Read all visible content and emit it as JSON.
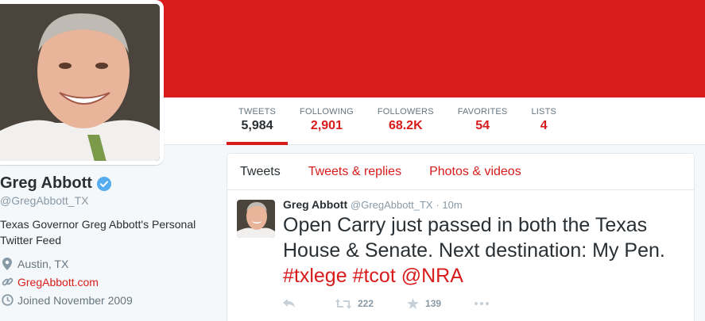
{
  "theme": {
    "accent": "#d81b1b",
    "text": "#292f33",
    "muted": "#8899a6"
  },
  "stats": [
    {
      "label": "TWEETS",
      "value": "5,984"
    },
    {
      "label": "FOLLOWING",
      "value": "2,901"
    },
    {
      "label": "FOLLOWERS",
      "value": "68.2K"
    },
    {
      "label": "FAVORITES",
      "value": "54"
    },
    {
      "label": "LISTS",
      "value": "4"
    }
  ],
  "profile": {
    "name": "Greg Abbott",
    "handle": "@GregAbbott_TX",
    "bio": "Texas Governor Greg Abbott's Personal Twitter Feed",
    "location": "Austin, TX",
    "url": "GregAbbott.com",
    "joined": "Joined November 2009",
    "icons": [
      "location-pin-icon",
      "link-icon",
      "calendar-clock-icon",
      "verified-badge-icon"
    ]
  },
  "tabs": [
    "Tweets",
    "Tweets & replies",
    "Photos & videos"
  ],
  "tweet": {
    "name": "Greg Abbott",
    "handle": "@GregAbbott_TX",
    "time": "· 10m",
    "text_line1": "Open Carry just passed in both the Texas",
    "text_line2": "House & Senate. Next destination: My Pen.",
    "tag1": "#txlege",
    "tag2": "#tcot",
    "mention": "@NRA",
    "retweets": "222",
    "favorites": "139",
    "icons": [
      "reply-icon",
      "retweet-icon",
      "star-icon",
      "more-icon"
    ]
  }
}
